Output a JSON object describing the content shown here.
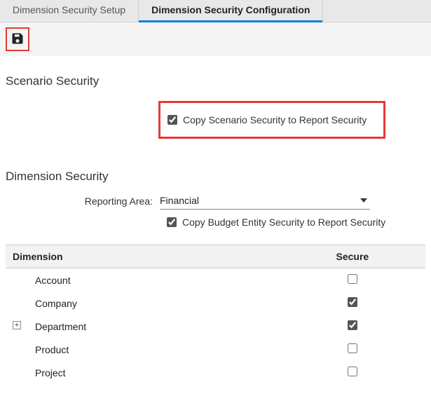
{
  "tabs": [
    {
      "label": "Dimension Security Setup",
      "active": false
    },
    {
      "label": "Dimension Security Configuration",
      "active": true
    }
  ],
  "sections": {
    "scenario_title": "Scenario Security",
    "dimension_title": "Dimension Security"
  },
  "scenario": {
    "copy_label": "Copy Scenario Security to Report Security",
    "copy_checked": true
  },
  "dimension": {
    "reporting_area_label": "Reporting Area:",
    "reporting_area_value": "Financial",
    "copy_label": "Copy Budget Entity Security to Report Security",
    "copy_checked": true
  },
  "table": {
    "headers": {
      "dimension": "Dimension",
      "secure": "Secure"
    },
    "rows": [
      {
        "name": "Account",
        "secure": false,
        "expandable": false
      },
      {
        "name": "Company",
        "secure": true,
        "expandable": false
      },
      {
        "name": "Department",
        "secure": true,
        "expandable": true
      },
      {
        "name": "Product",
        "secure": false,
        "expandable": false
      },
      {
        "name": "Project",
        "secure": false,
        "expandable": false
      }
    ]
  }
}
